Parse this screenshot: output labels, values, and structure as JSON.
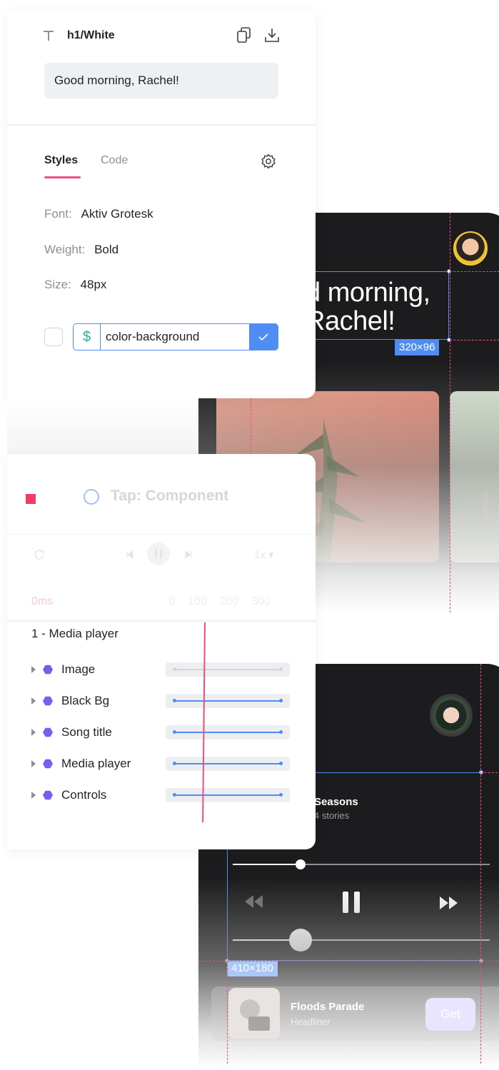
{
  "inspector": {
    "layer_name": "h1/White",
    "text_value": "Good morning, Rachel!",
    "tabs": [
      {
        "label": "Styles"
      },
      {
        "label": "Code"
      }
    ],
    "props": {
      "font_label": "Font:",
      "font_value": "Aktiv Grotesk",
      "weight_label": "Weight:",
      "weight_value": "Bold",
      "size_label": "Size:",
      "size_value": "48px"
    },
    "token": {
      "prefix": "$",
      "value": "color-background"
    }
  },
  "canvas_top": {
    "greeting_line1": "d morning,",
    "greeting_line2": "Rachel!",
    "dimensions": "320×96"
  },
  "animation": {
    "title": "Tap: Component",
    "speed": "1x",
    "time": "0ms",
    "ticks": [
      "0",
      "100",
      "200",
      "300"
    ],
    "group": "1 - Media player",
    "layers": [
      {
        "label": "Image"
      },
      {
        "label": "Black Bg"
      },
      {
        "label": "Song title"
      },
      {
        "label": "Media player"
      },
      {
        "label": "Controls"
      }
    ]
  },
  "canvas_bottom": {
    "title": "Seasons",
    "subtitle": "4 stories",
    "dimensions": "410×180",
    "album_title": "Floods Parade",
    "album_sub": "Headliner",
    "get_label": "Get"
  },
  "colors": {
    "accent_pink": "#ef4d7a",
    "selection_blue": "#4f8df5",
    "layer_purple": "#7b5cf0"
  }
}
